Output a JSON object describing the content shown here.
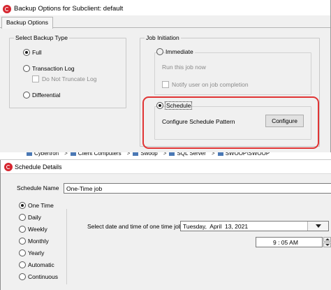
{
  "backup_dialog": {
    "title": "Backup Options for Subclient: default",
    "tab": "Backup Options",
    "backup_type": {
      "legend": "Select Backup Type",
      "full": "Full",
      "transaction_log": "Transaction Log",
      "do_not_truncate": "Do Not Truncate Log",
      "differential": "Differential"
    },
    "job_initiation": {
      "legend": "Job Initiation",
      "immediate": "Immediate",
      "run_now": "Run this job now",
      "notify": "Notify user on job completion",
      "schedule": "Schedule",
      "configure_label": "Configure Schedule Pattern",
      "configure_button": "Configure"
    }
  },
  "breadcrumb": {
    "items": [
      "Cybertron",
      "Client Computers",
      "Swoop",
      "SQL Server",
      "SWOOP\\SWOOP"
    ],
    "separator": ">"
  },
  "schedule_dialog": {
    "title": "Schedule Details",
    "name_label": "Schedule Name",
    "name_value": "One-Time job",
    "frequencies": [
      "One Time",
      "Daily",
      "Weekly",
      "Monthly",
      "Yearly",
      "Automatic",
      "Continuous"
    ],
    "selected_frequency": "One Time",
    "date_time_label": "Select date and time of one time job",
    "date_value": "Tuesday,  April  13, 2021",
    "time_value": "9 : 05 AM"
  },
  "colors": {
    "highlight_border": "#e03434",
    "brand_logo": "#d6262f"
  },
  "icons": {
    "app_logo": "commvault-logo-icon",
    "crumb_item": "node-icon"
  }
}
